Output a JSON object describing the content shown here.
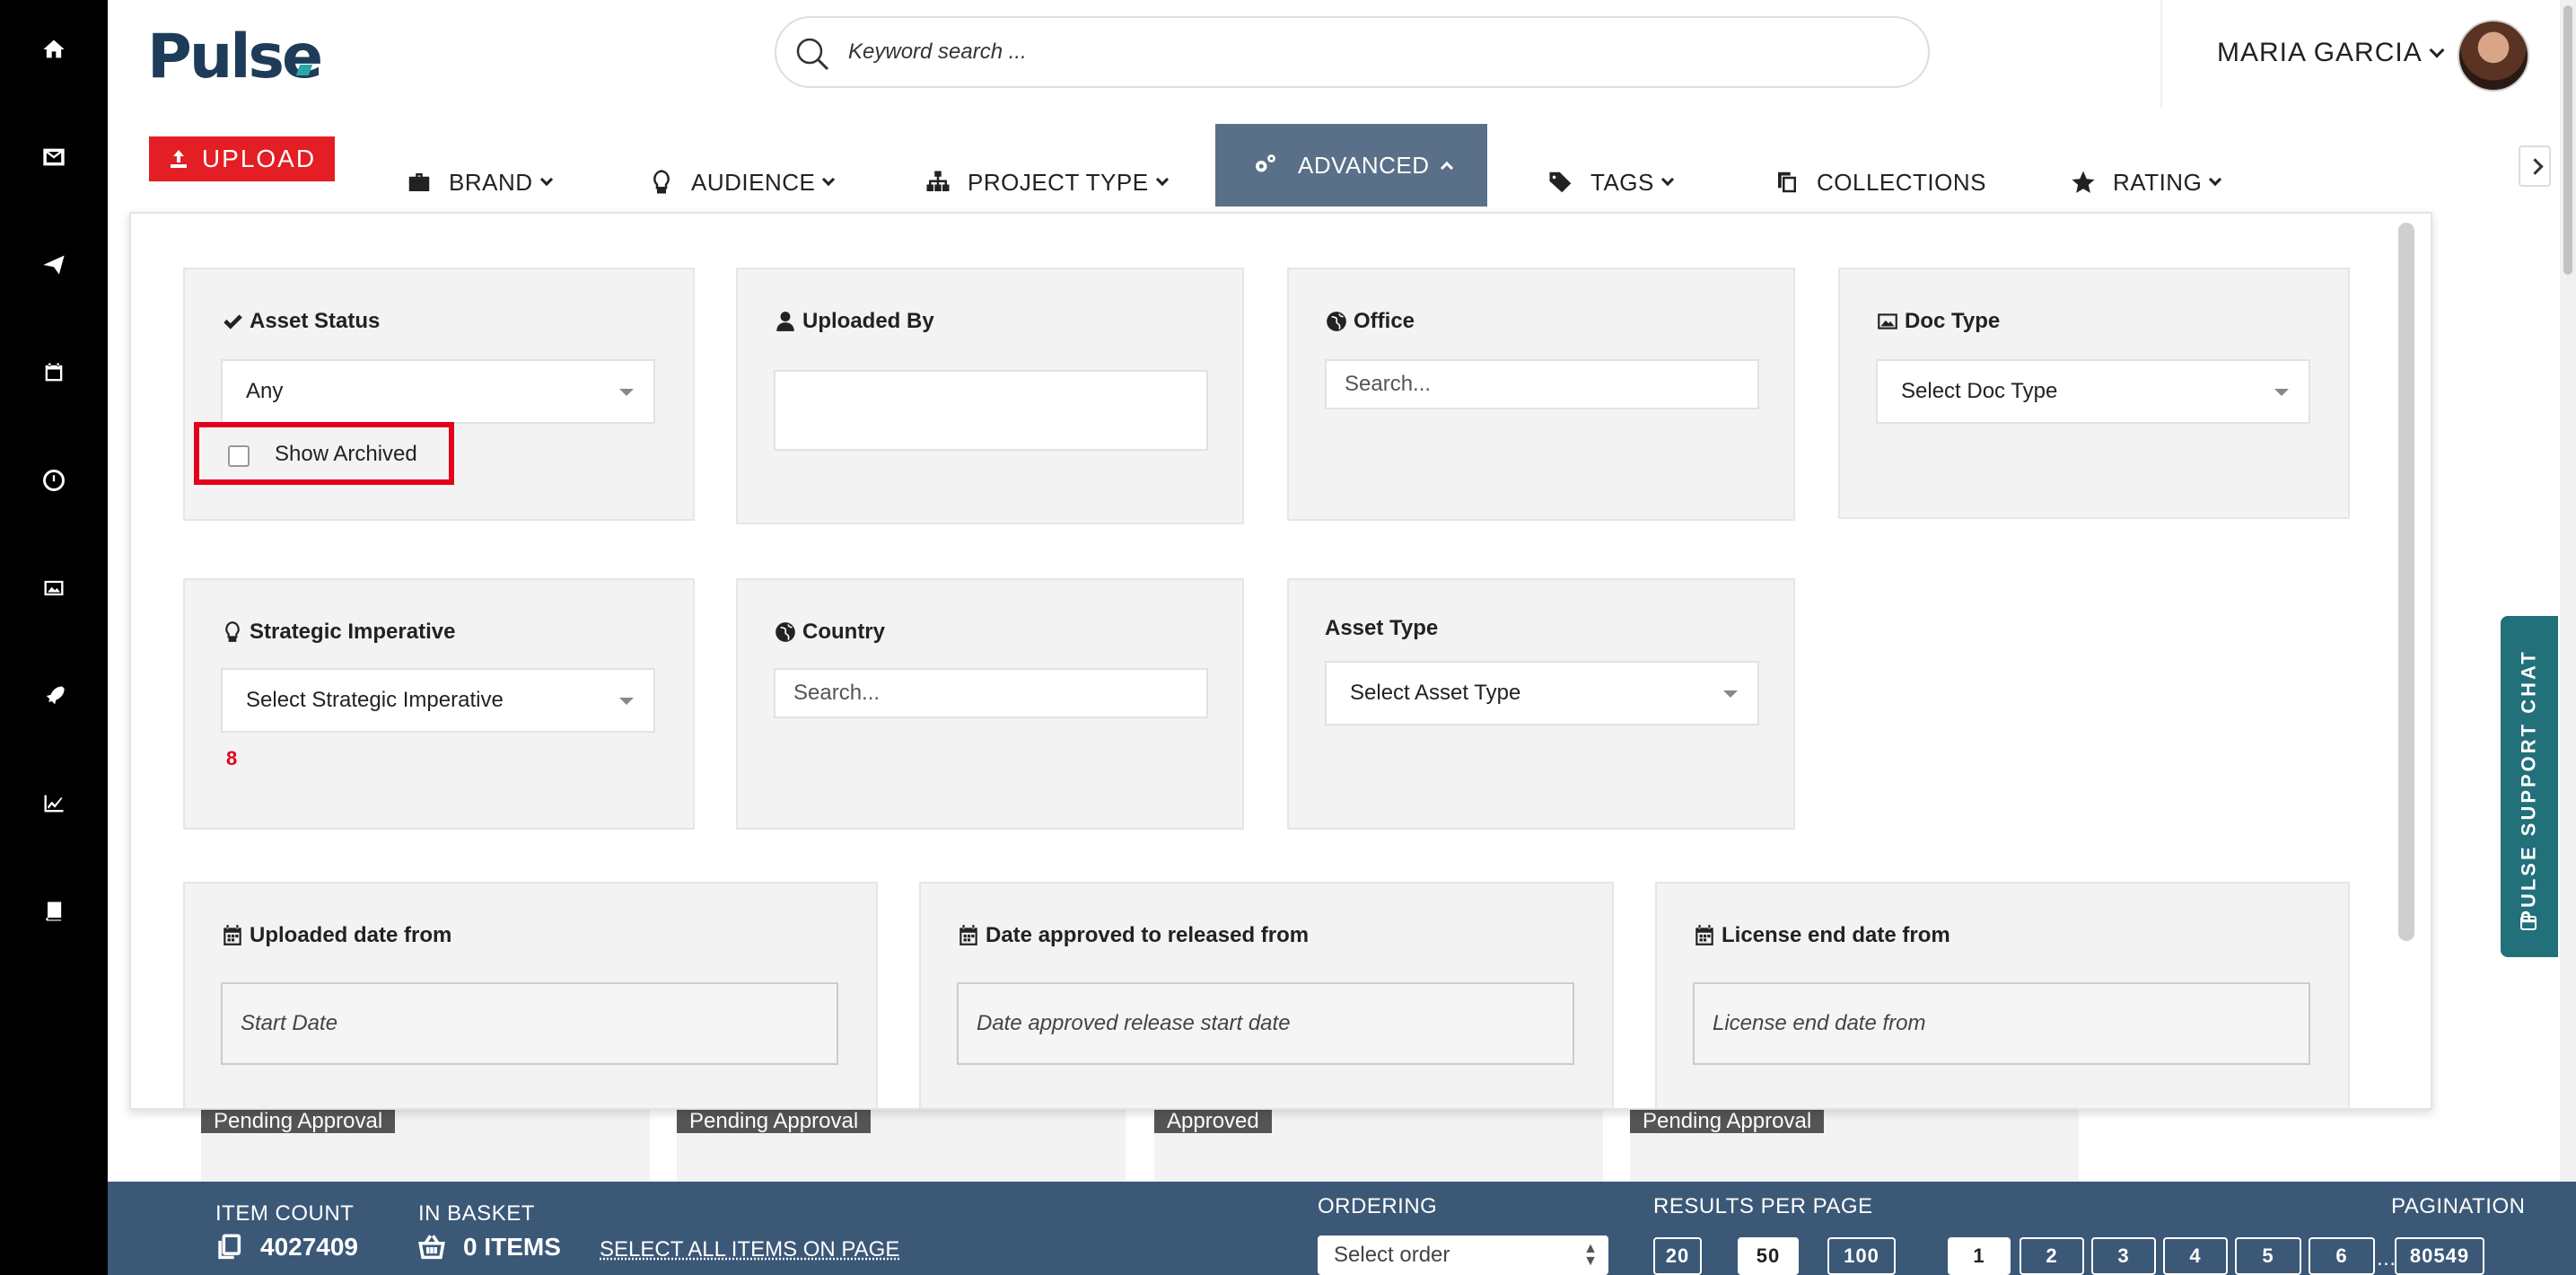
{
  "header": {
    "logo": "Pulse",
    "search_placeholder": "Keyword search ...",
    "user_name": "MARIA GARCIA"
  },
  "toolbar": {
    "upload_label": "UPLOAD",
    "filters": [
      {
        "label": "BRAND",
        "icon": "briefcase-icon"
      },
      {
        "label": "AUDIENCE",
        "icon": "lightbulb-icon"
      },
      {
        "label": "PROJECT TYPE",
        "icon": "sitemap-icon"
      },
      {
        "label": "ADVANCED",
        "icon": "gears-icon",
        "active": true
      },
      {
        "label": "TAGS",
        "icon": "tags-icon"
      },
      {
        "label": "COLLECTIONS",
        "icon": "copy-icon"
      },
      {
        "label": "RATING",
        "icon": "star-icon"
      }
    ]
  },
  "advanced": {
    "asset_status": {
      "label": "Asset Status",
      "value": "Any",
      "show_archived_label": "Show Archived",
      "show_archived_checked": false
    },
    "uploaded_by": {
      "label": "Uploaded By",
      "value": ""
    },
    "office": {
      "label": "Office",
      "placeholder": "Search..."
    },
    "doc_type": {
      "label": "Doc Type",
      "value": "Select Doc Type"
    },
    "strategic_imperative": {
      "label": "Strategic Imperative",
      "value": "Select Strategic Imperative",
      "count": "8"
    },
    "country": {
      "label": "Country",
      "placeholder": "Search..."
    },
    "asset_type": {
      "label": "Asset Type",
      "value": "Select Asset Type"
    },
    "uploaded_date_from": {
      "label": "Uploaded date from",
      "placeholder": "Start Date"
    },
    "date_approved_from": {
      "label": "Date approved to released from",
      "placeholder": "Date approved release start date"
    },
    "license_end_from": {
      "label": "License end date from",
      "placeholder": "License end date from"
    }
  },
  "background": {
    "thumb_labels": [
      "Pending Approval",
      "Pending Approval",
      "Approved",
      "Pending Approval"
    ]
  },
  "chat": {
    "label": "PULSE SUPPORT CHAT"
  },
  "footer": {
    "item_count_label": "ITEM COUNT",
    "item_count": "4027409",
    "in_basket_label": "IN BASKET",
    "in_basket": "0 ITEMS",
    "select_all_label": "SELECT ALL ITEMS ON PAGE",
    "ordering_label": "ORDERING",
    "ordering_value": "Select order",
    "results_label": "RESULTS PER PAGE",
    "results_options": [
      "20",
      "50",
      "100"
    ],
    "results_selected": "50",
    "pagination_label": "PAGINATION",
    "pages": [
      "1",
      "2",
      "3",
      "4",
      "5",
      "6"
    ],
    "ellipsis": "...",
    "last_page": "80549",
    "current_page": "1"
  },
  "colors": {
    "accent_red": "#e31e24",
    "active_filter": "#5a7089",
    "footer_bg": "#3b5877",
    "chat_bg": "#21707a",
    "logo": "#1e3c5a"
  }
}
